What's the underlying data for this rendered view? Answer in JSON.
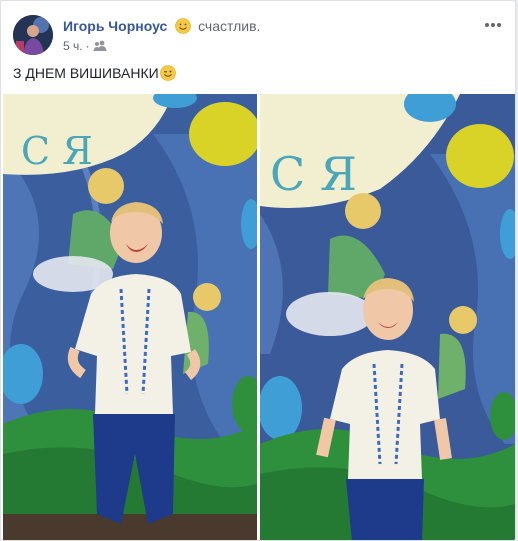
{
  "post": {
    "author": "Игорь Чорноус",
    "feeling": "счастлив.",
    "time": "5 ч.",
    "separator": "·",
    "audience_icon": "friends-icon",
    "feeling_icon": "smiling-face-icon",
    "more_icon": "more-options-icon",
    "text": "З ДНЕМ ВИШИВАНКИ",
    "text_emoji": "winking-face-icon"
  },
  "photos": [
    {
      "name": "photo-1",
      "banner_text": "С Я"
    },
    {
      "name": "photo-2",
      "banner_text": "С Я"
    }
  ],
  "colors": {
    "author": "#365899",
    "meta": "#616770",
    "text": "#1d2129",
    "backdrop": "#4b74b6",
    "grass": "#2e8f3c",
    "balloon_yellow": "#d8d326",
    "balloon_blue": "#3f9ed6"
  }
}
